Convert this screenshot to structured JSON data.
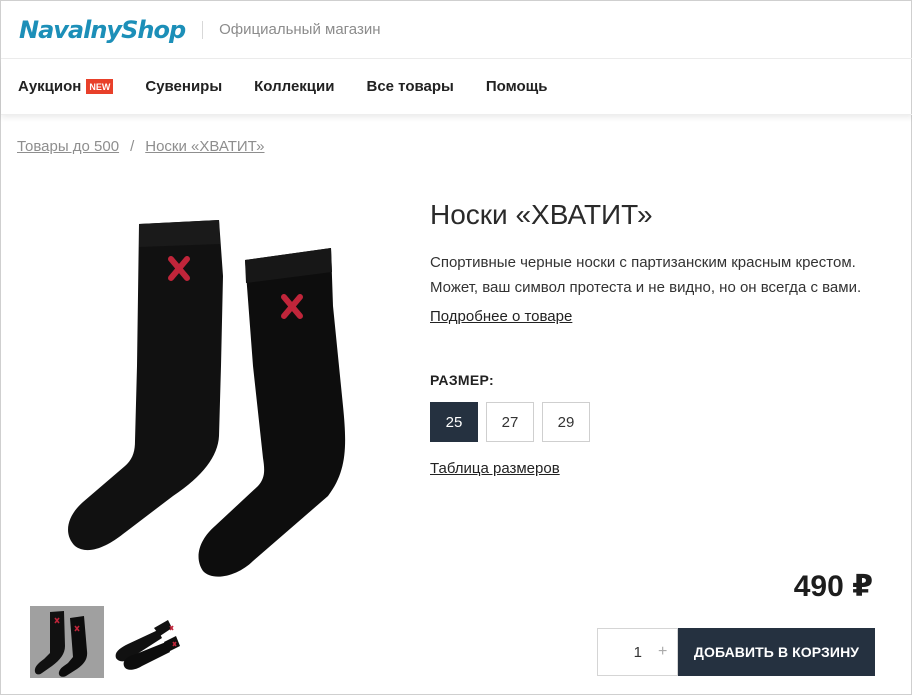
{
  "header": {
    "logo": "NavalnyShop",
    "tagline": "Официальный магазин"
  },
  "nav": {
    "items": [
      {
        "label": "Аукцион",
        "badge": "NEW"
      },
      {
        "label": "Сувениры"
      },
      {
        "label": "Коллекции"
      },
      {
        "label": "Все товары"
      },
      {
        "label": "Помощь"
      }
    ]
  },
  "breadcrumb": {
    "items": [
      "Товары до 500",
      "Носки «ХВАТИТ»"
    ],
    "separator": "/"
  },
  "product": {
    "title": "Носки «ХВАТИТ»",
    "description": "Спортивные черные носки с партизанским красным крестом. Может, ваш символ протеста и не видно, но он всегда с вами.",
    "more_link": "Подробнее о товаре",
    "size_label": "РАЗМЕР:",
    "sizes": [
      "25",
      "27",
      "29"
    ],
    "selected_size": "25",
    "size_table_link": "Таблица размеров",
    "price": "490 ₽",
    "quantity": "1",
    "quantity_plus": "+",
    "add_to_cart": "ДОБАВИТЬ В КОРЗИНУ"
  },
  "colors": {
    "brand": "#1c8fb8",
    "badge": "#e8402a",
    "dark_button": "#253140",
    "cross": "#c0253a"
  },
  "icons": [
    "plus-icon"
  ]
}
